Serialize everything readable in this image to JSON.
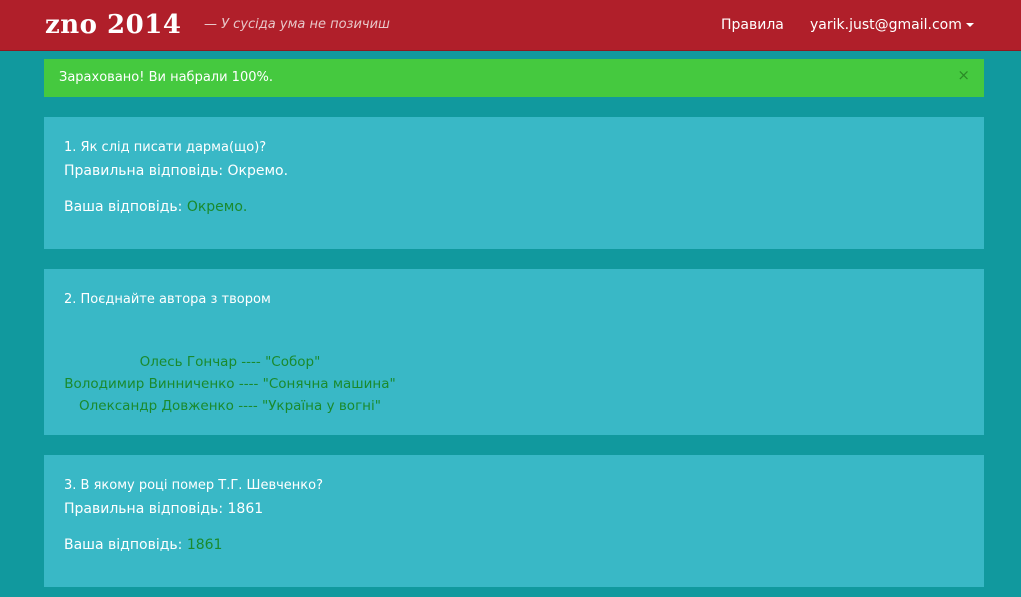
{
  "navbar": {
    "brand": "zno 2014",
    "tagline": "— У сусіда ума не позичиш",
    "rules_link": "Правила",
    "user_email": "yarik.just@gmail.com"
  },
  "alert": {
    "message": "Зараховано! Ви набрали 100%.",
    "close": "×"
  },
  "questions": [
    {
      "text": "1. Як слід писати дарма(що)?",
      "correct_label": "Правильна відповідь: ",
      "correct_value": "Окремо.",
      "your_label": "Ваша відповідь: ",
      "your_value": "Окремо."
    },
    {
      "text": "2. Поєднайте автора з твором",
      "pairs": [
        "Олесь Гончар ---- \"Собор\"",
        "Володимир Винниченко ---- \"Сонячна машина\"",
        "Олександр Довженко ---- \"Україна у вогні\""
      ]
    },
    {
      "text": "3. В якому році помер Т.Г. Шевченко?",
      "correct_label": "Правильна відповідь: ",
      "correct_value": "1861",
      "your_label": "Ваша відповідь: ",
      "your_value": "1861"
    }
  ],
  "colors": {
    "navbar_bg": "#b01f2a",
    "page_bg": "#11999e",
    "card_bg": "#39b8c6",
    "alert_bg": "#45c93f",
    "answer_green": "#1a8a2d"
  }
}
